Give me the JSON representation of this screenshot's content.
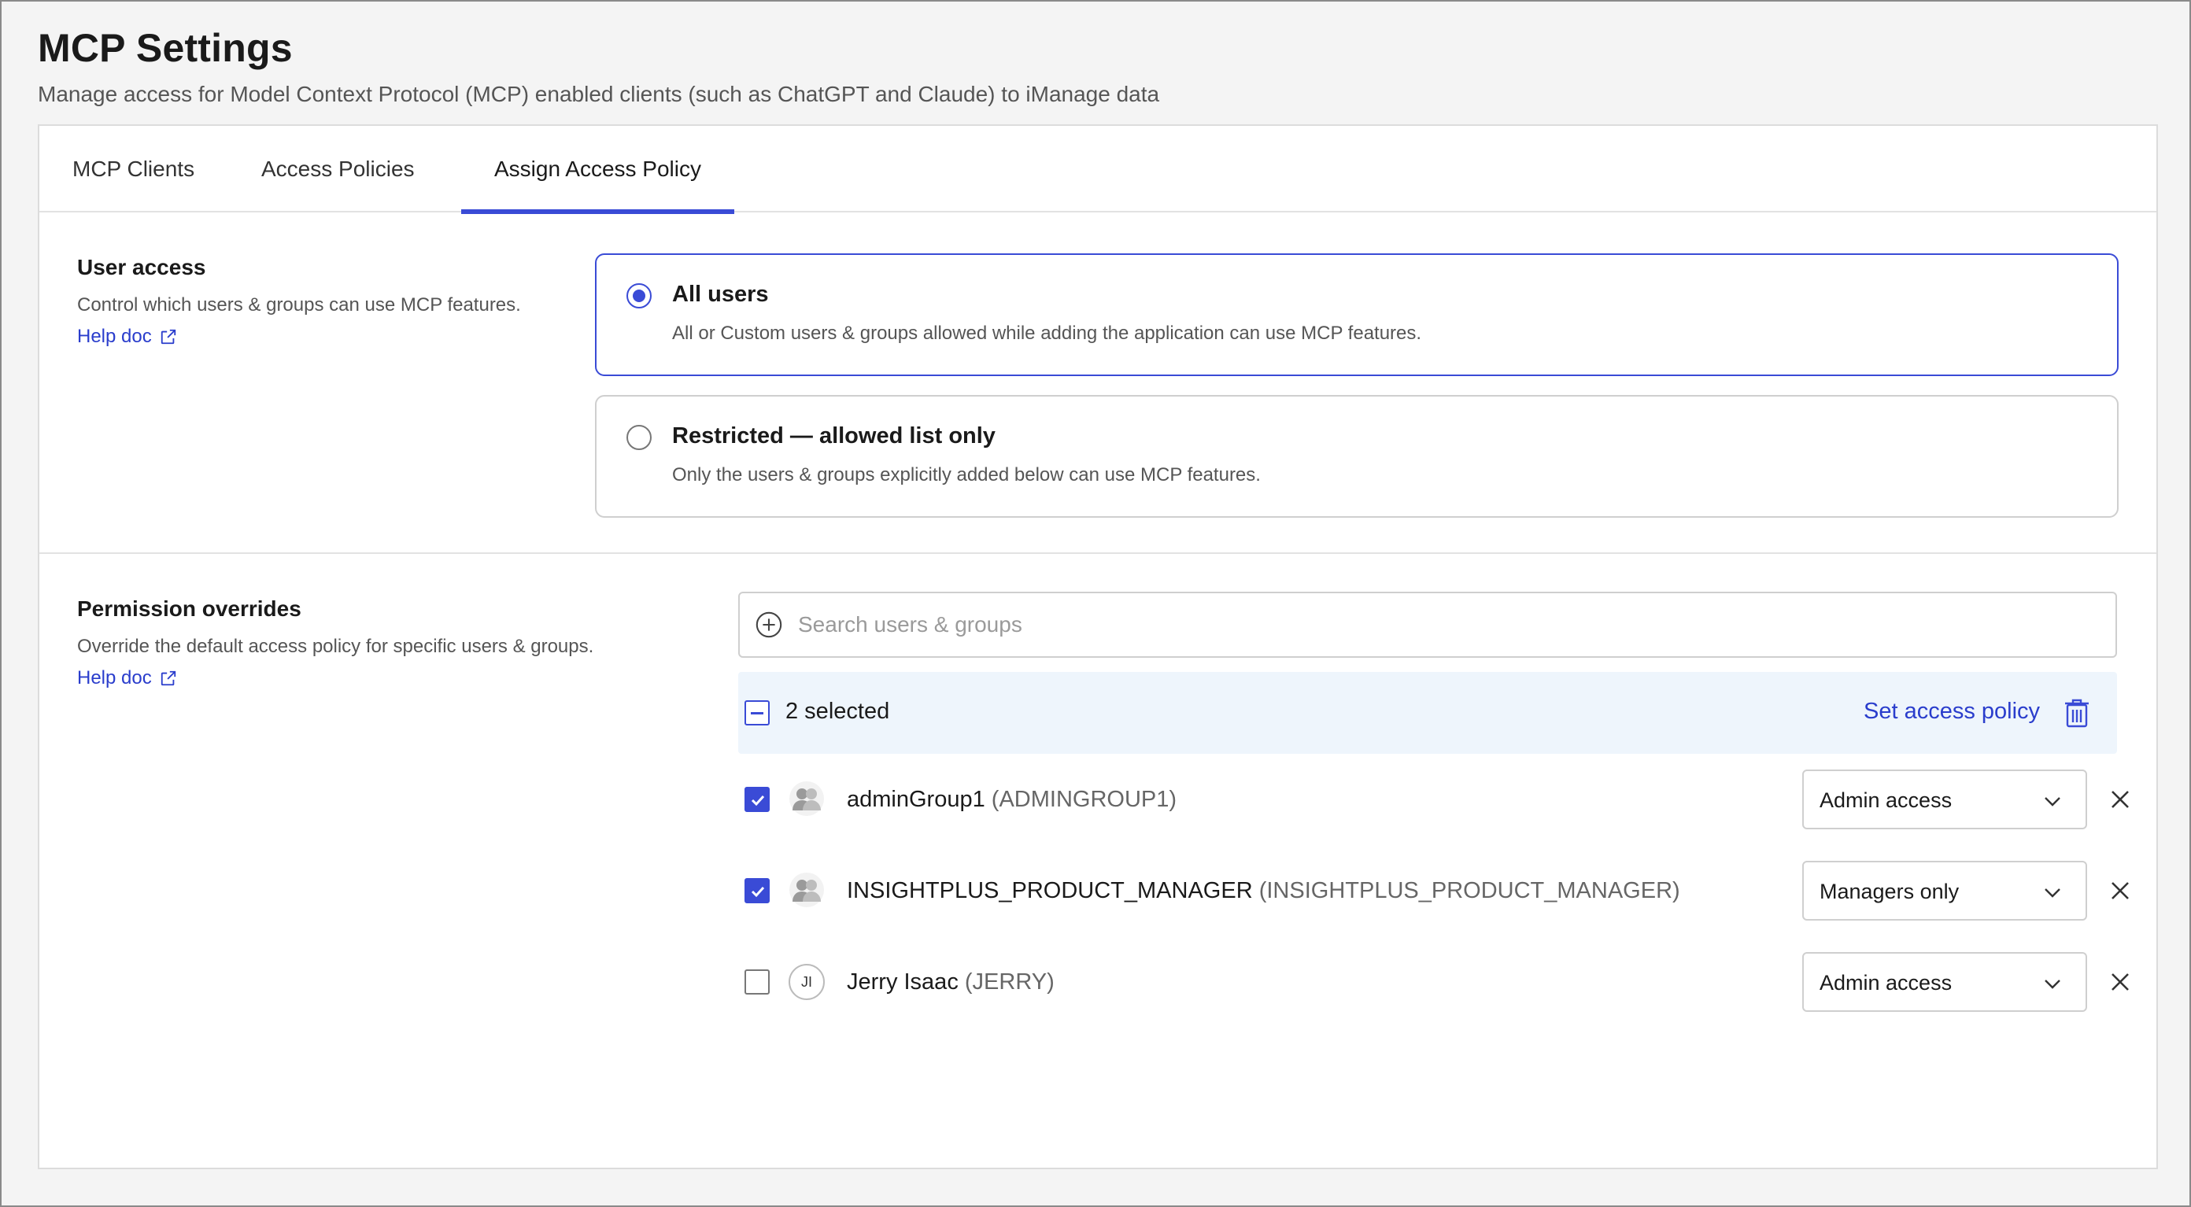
{
  "header": {
    "title": "MCP Settings",
    "subtitle": "Manage access for Model Context Protocol (MCP) enabled clients (such as ChatGPT and Claude) to iManage data"
  },
  "tabs": [
    {
      "label": "MCP Clients",
      "active": false
    },
    {
      "label": "Access Policies",
      "active": false
    },
    {
      "label": "Assign Access Policy",
      "active": true
    }
  ],
  "user_access": {
    "label": "User access",
    "description": "Control which users & groups can use MCP features.",
    "help_label": "Help doc",
    "options": [
      {
        "title": "All users",
        "description": "All or Custom users & groups allowed while adding the application can use MCP features.",
        "selected": true
      },
      {
        "title": "Restricted — allowed list only",
        "description": "Only the users & groups explicitly added below can use MCP features.",
        "selected": false
      }
    ]
  },
  "permission_overrides": {
    "label": "Permission overrides",
    "description": "Override the default access policy for specific users & groups.",
    "help_label": "Help doc",
    "search_placeholder": "Search users & groups",
    "selected_count_label": "2 selected",
    "set_policy_label": "Set access policy",
    "rows": [
      {
        "name": "adminGroup1",
        "id": "(ADMINGROUP1)",
        "checked": true,
        "type": "group",
        "policy": "Admin access"
      },
      {
        "name": "INSIGHTPLUS_PRODUCT_MANAGER",
        "id": "(INSIGHTPLUS_PRODUCT_MANAGER)",
        "checked": true,
        "type": "group",
        "policy": "Managers only"
      },
      {
        "name": "Jerry Isaac",
        "id": "(JERRY)",
        "checked": false,
        "type": "user",
        "initials": "JI",
        "policy": "Admin access"
      }
    ]
  },
  "colors": {
    "accent": "#3a4bd6",
    "link": "#2a3dcc",
    "bulk_bar_bg": "#eef5fc"
  },
  "icons": [
    "external-link-icon",
    "plus-circle-icon",
    "trash-icon",
    "group-icon",
    "chevron-down-icon",
    "close-icon",
    "checkmark-icon"
  ]
}
